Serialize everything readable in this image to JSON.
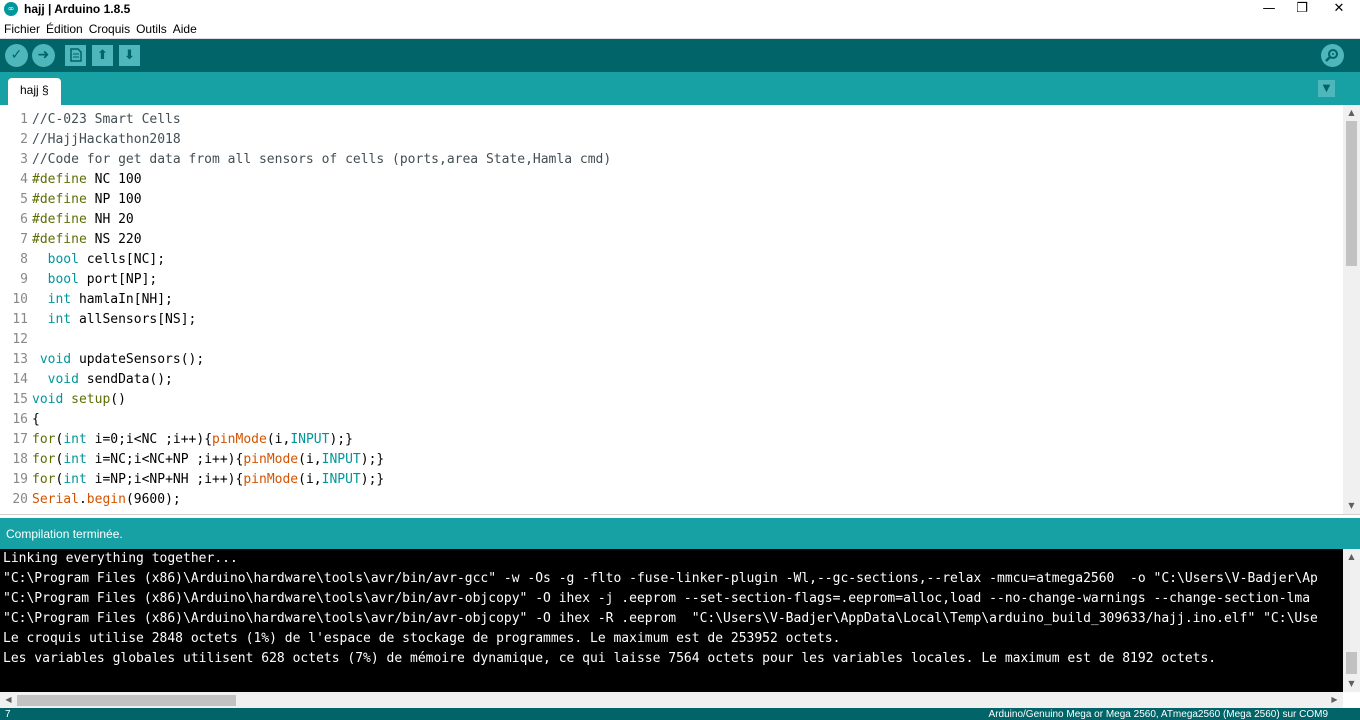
{
  "window": {
    "title": "hajj | Arduino 1.8.5",
    "minimize_glyph": "—",
    "maximize_glyph": "❐",
    "close_glyph": "✕"
  },
  "menu": [
    "Fichier",
    "Édition",
    "Croquis",
    "Outils",
    "Aide"
  ],
  "toolbar": {
    "buttons": [
      "verify-icon",
      "upload-icon",
      "new-icon",
      "open-icon",
      "save-icon"
    ],
    "serial_monitor": "serial-monitor-icon"
  },
  "tab": {
    "label": "hajj §"
  },
  "editor": {
    "line_numbers": [
      "1",
      "2",
      "3",
      "4",
      "5",
      "6",
      "7",
      "8",
      "9",
      "10",
      "11",
      "12",
      "13",
      "14",
      "15",
      "16",
      "17",
      "18",
      "19",
      "20"
    ],
    "lines": [
      [
        {
          "t": "//C-023 Smart Cells",
          "c": "comment"
        }
      ],
      [
        {
          "t": "//HajjHackathon2018",
          "c": "comment"
        }
      ],
      [
        {
          "t": "//Code for get data from all sensors of cells (ports,area State,Hamla cmd)",
          "c": "comment"
        }
      ],
      [
        {
          "t": "#define",
          "c": "pre"
        },
        {
          "t": " NC 100",
          "c": ""
        }
      ],
      [
        {
          "t": "#define",
          "c": "pre"
        },
        {
          "t": " NP 100",
          "c": ""
        }
      ],
      [
        {
          "t": "#define",
          "c": "pre"
        },
        {
          "t": " NH 20",
          "c": ""
        }
      ],
      [
        {
          "t": "#define",
          "c": "pre"
        },
        {
          "t": " NS 220",
          "c": ""
        }
      ],
      [
        {
          "t": "  ",
          "c": ""
        },
        {
          "t": "bool",
          "c": "type"
        },
        {
          "t": " cells[NC];",
          "c": ""
        }
      ],
      [
        {
          "t": "  ",
          "c": ""
        },
        {
          "t": "bool",
          "c": "type"
        },
        {
          "t": " port[NP];",
          "c": ""
        }
      ],
      [
        {
          "t": "  ",
          "c": ""
        },
        {
          "t": "int",
          "c": "type"
        },
        {
          "t": " hamlaIn[NH];",
          "c": ""
        }
      ],
      [
        {
          "t": "  ",
          "c": ""
        },
        {
          "t": "int",
          "c": "type"
        },
        {
          "t": " allSensors[NS];",
          "c": ""
        }
      ],
      [],
      [
        {
          "t": " ",
          "c": ""
        },
        {
          "t": "void",
          "c": "type"
        },
        {
          "t": " updateSensors();",
          "c": ""
        }
      ],
      [
        {
          "t": "  ",
          "c": ""
        },
        {
          "t": "void",
          "c": "type"
        },
        {
          "t": " sendData();",
          "c": ""
        }
      ],
      [
        {
          "t": "void",
          "c": "type"
        },
        {
          "t": " ",
          "c": ""
        },
        {
          "t": "setup",
          "c": "kw"
        },
        {
          "t": "()",
          "c": ""
        }
      ],
      [
        {
          "t": "{",
          "c": ""
        }
      ],
      [
        {
          "t": "for",
          "c": "kw"
        },
        {
          "t": "(",
          "c": ""
        },
        {
          "t": "int",
          "c": "type"
        },
        {
          "t": " i=0;i<NC ;i++){",
          "c": ""
        },
        {
          "t": "pinMode",
          "c": "fn"
        },
        {
          "t": "(i,",
          "c": ""
        },
        {
          "t": "INPUT",
          "c": "const"
        },
        {
          "t": ");}",
          "c": ""
        }
      ],
      [
        {
          "t": "for",
          "c": "kw"
        },
        {
          "t": "(",
          "c": ""
        },
        {
          "t": "int",
          "c": "type"
        },
        {
          "t": " i=NC;i<NC+NP ;i++){",
          "c": ""
        },
        {
          "t": "pinMode",
          "c": "fn"
        },
        {
          "t": "(i,",
          "c": ""
        },
        {
          "t": "INPUT",
          "c": "const"
        },
        {
          "t": ");}",
          "c": ""
        }
      ],
      [
        {
          "t": "for",
          "c": "kw"
        },
        {
          "t": "(",
          "c": ""
        },
        {
          "t": "int",
          "c": "type"
        },
        {
          "t": " i=NP;i<NP+NH ;i++){",
          "c": ""
        },
        {
          "t": "pinMode",
          "c": "fn"
        },
        {
          "t": "(i,",
          "c": ""
        },
        {
          "t": "INPUT",
          "c": "const"
        },
        {
          "t": ");}",
          "c": ""
        }
      ],
      [
        {
          "t": "Serial",
          "c": "fn"
        },
        {
          "t": ".",
          "c": ""
        },
        {
          "t": "begin",
          "c": "fn"
        },
        {
          "t": "(9600);",
          "c": ""
        }
      ]
    ]
  },
  "status": {
    "message": "Compilation terminée."
  },
  "console": {
    "lines": [
      "Linking everything together...",
      "\"C:\\Program Files (x86)\\Arduino\\hardware\\tools\\avr/bin/avr-gcc\" -w -Os -g -flto -fuse-linker-plugin -Wl,--gc-sections,--relax -mmcu=atmega2560  -o \"C:\\Users\\V-Badjer\\Ap",
      "\"C:\\Program Files (x86)\\Arduino\\hardware\\tools\\avr/bin/avr-objcopy\" -O ihex -j .eeprom --set-section-flags=.eeprom=alloc,load --no-change-warnings --change-section-lma",
      "\"C:\\Program Files (x86)\\Arduino\\hardware\\tools\\avr/bin/avr-objcopy\" -O ihex -R .eeprom  \"C:\\Users\\V-Badjer\\AppData\\Local\\Temp\\arduino_build_309633/hajj.ino.elf\" \"C:\\Use",
      "Le croquis utilise 2848 octets (1%) de l'espace de stockage de programmes. Le maximum est de 253952 octets.",
      "Les variables globales utilisent 628 octets (7%) de mémoire dynamique, ce qui laisse 7564 octets pour les variables locales. Le maximum est de 8192 octets."
    ]
  },
  "footer": {
    "line_number": "7",
    "board": "Arduino/Genuino Mega or Mega 2560, ATmega2560 (Mega 2560) sur COM9"
  },
  "colors": {
    "toolbar": "#006468",
    "tabbar": "#17a1a5",
    "button": "#4db7bb",
    "console_bg": "#000000"
  }
}
